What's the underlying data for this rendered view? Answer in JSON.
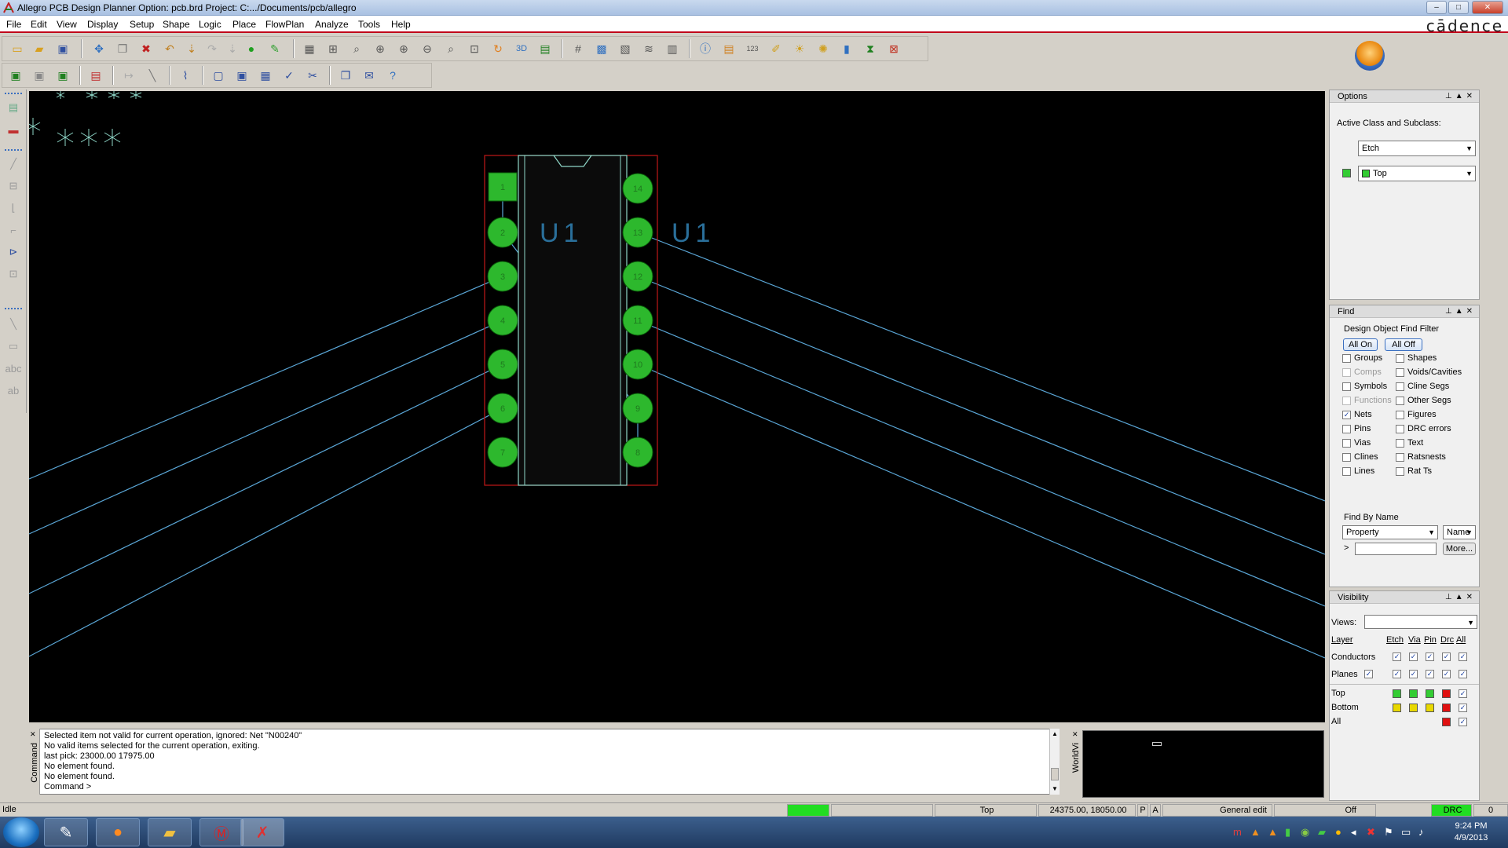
{
  "title": "Allegro PCB Design Planner Option: pcb.brd  Project: C:.../Documents/pcb/allegro",
  "brand": "cādence",
  "menu": [
    "File",
    "Edit",
    "View",
    "Display",
    "Setup",
    "Shape",
    "Logic",
    "Place",
    "FlowPlan",
    "Analyze",
    "Tools",
    "Help"
  ],
  "canvas": {
    "refdes_left": "U1",
    "refdes_right": "U1",
    "pin_numbers_left": [
      "1",
      "2",
      "3",
      "4",
      "5",
      "6",
      "7"
    ],
    "pin_numbers_right": [
      "14",
      "13",
      "12",
      "11",
      "10",
      "9",
      "8"
    ],
    "colors": {
      "background": "#000000",
      "pad": "#2db82d",
      "outline": "#c01818",
      "silk": "#8fd7c8",
      "ratsnest": "#5aa6d6",
      "refdes": "#2a6f9a"
    }
  },
  "console": {
    "lines": [
      "Selected item not valid for current operation, ignored: Net \"N00240\"",
      "No valid items selected for the current operation, exiting.",
      "last pick:  23000.00  17975.00",
      "No element found.",
      "No element found.",
      "Command >"
    ],
    "side_label": "Command",
    "worldview_label": "WorldVi"
  },
  "options": {
    "title": "Options",
    "heading": "Active Class and Subclass:",
    "class_value": "Etch",
    "subclass_value": "Top"
  },
  "find": {
    "title": "Find",
    "heading": "Design Object Find Filter",
    "all_on": "All On",
    "all_off": "All Off",
    "left": [
      {
        "label": "Groups",
        "checked": false,
        "enabled": true
      },
      {
        "label": "Comps",
        "checked": false,
        "enabled": false
      },
      {
        "label": "Symbols",
        "checked": false,
        "enabled": true
      },
      {
        "label": "Functions",
        "checked": false,
        "enabled": false
      },
      {
        "label": "Nets",
        "checked": true,
        "enabled": true
      },
      {
        "label": "Pins",
        "checked": false,
        "enabled": true
      },
      {
        "label": "Vias",
        "checked": false,
        "enabled": true
      },
      {
        "label": "Clines",
        "checked": false,
        "enabled": true
      },
      {
        "label": "Lines",
        "checked": false,
        "enabled": true
      }
    ],
    "right": [
      {
        "label": "Shapes",
        "checked": false,
        "enabled": true
      },
      {
        "label": "Voids/Cavities",
        "checked": false,
        "enabled": true
      },
      {
        "label": "Cline Segs",
        "checked": false,
        "enabled": true
      },
      {
        "label": "Other Segs",
        "checked": false,
        "enabled": true
      },
      {
        "label": "Figures",
        "checked": false,
        "enabled": true
      },
      {
        "label": "DRC errors",
        "checked": false,
        "enabled": true
      },
      {
        "label": "Text",
        "checked": false,
        "enabled": true
      },
      {
        "label": "Ratsnests",
        "checked": false,
        "enabled": true
      },
      {
        "label": "Rat Ts",
        "checked": false,
        "enabled": true
      }
    ],
    "find_by_name": "Find By Name",
    "property": "Property",
    "name": "Name",
    "prompt": ">",
    "more": "More..."
  },
  "visibility": {
    "title": "Visibility",
    "views_label": "Views:",
    "columns": [
      "Layer",
      "Etch",
      "Via",
      "Pin",
      "Drc",
      "All"
    ],
    "conductors": "Conductors",
    "planes": "Planes",
    "layers": [
      {
        "name": "Top",
        "colors": [
          "#33cc33",
          "#33cc33",
          "#33cc33",
          "#e01010"
        ]
      },
      {
        "name": "Bottom",
        "colors": [
          "#e8d800",
          "#e8d800",
          "#e8d800",
          "#e01010"
        ]
      },
      {
        "name": "All",
        "colors": [
          "",
          "",
          "",
          "#e01010"
        ]
      }
    ]
  },
  "status": {
    "state": "Idle",
    "layer": "Top",
    "coords": "24375.00, 18050.00",
    "p": "P",
    "a": "A",
    "mode": "General edit",
    "off": "Off",
    "drc": "DRC",
    "count": "0"
  },
  "taskbar": {
    "time": "9:24 PM",
    "date": "4/9/2013"
  }
}
